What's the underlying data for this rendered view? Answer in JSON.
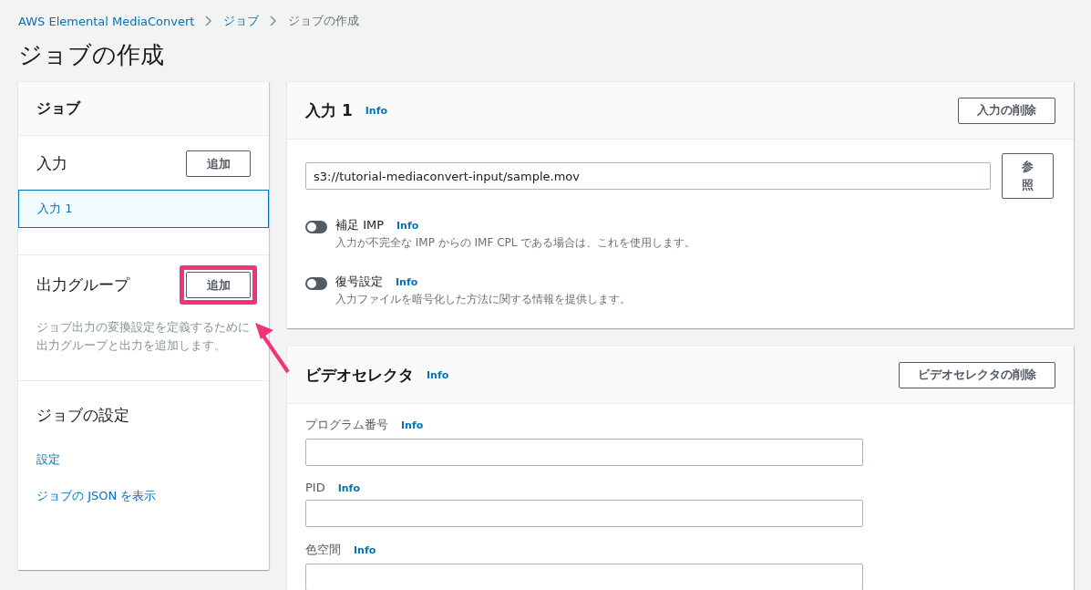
{
  "breadcrumb": [
    {
      "label": "AWS Elemental MediaConvert",
      "link": true
    },
    {
      "label": "ジョブ",
      "link": true
    },
    {
      "label": "ジョブの作成",
      "link": false
    }
  ],
  "page_title": "ジョブの作成",
  "sidebar": {
    "title": "ジョブ",
    "input_section": {
      "title": "入力",
      "add_button": "追加",
      "items": [
        {
          "label": "入力 1",
          "selected": true
        }
      ]
    },
    "output_section": {
      "title": "出力グループ",
      "add_button": "追加",
      "highlighted": true,
      "description": "ジョブ出力の変換設定を定義するために出力グループと出力を追加します。"
    },
    "settings_section": {
      "title": "ジョブの設定",
      "links": [
        "設定",
        "ジョブの JSON を表示"
      ]
    }
  },
  "input_panel": {
    "title": "入力 1",
    "info": "Info",
    "delete_button": "入力の削除",
    "file_value": "s3://tutorial-mediaconvert-input/sample.mov",
    "browse_button": "参照",
    "toggles": [
      {
        "label": "補足 IMP",
        "info": "Info",
        "description": "入力が不完全な IMP からの IMF CPL である場合は、これを使用します。",
        "on": false
      },
      {
        "label": "復号設定",
        "info": "Info",
        "description": "入力ファイルを暗号化した方法に関する情報を提供します。",
        "on": false
      }
    ]
  },
  "video_selector_panel": {
    "title": "ビデオセレクタ",
    "info": "Info",
    "delete_button": "ビデオセレクタの削除",
    "fields": [
      {
        "label": "プログラム番号",
        "info": "Info"
      },
      {
        "label": "PID",
        "info": "Info"
      },
      {
        "label": "色空間",
        "info": "Info"
      }
    ]
  }
}
